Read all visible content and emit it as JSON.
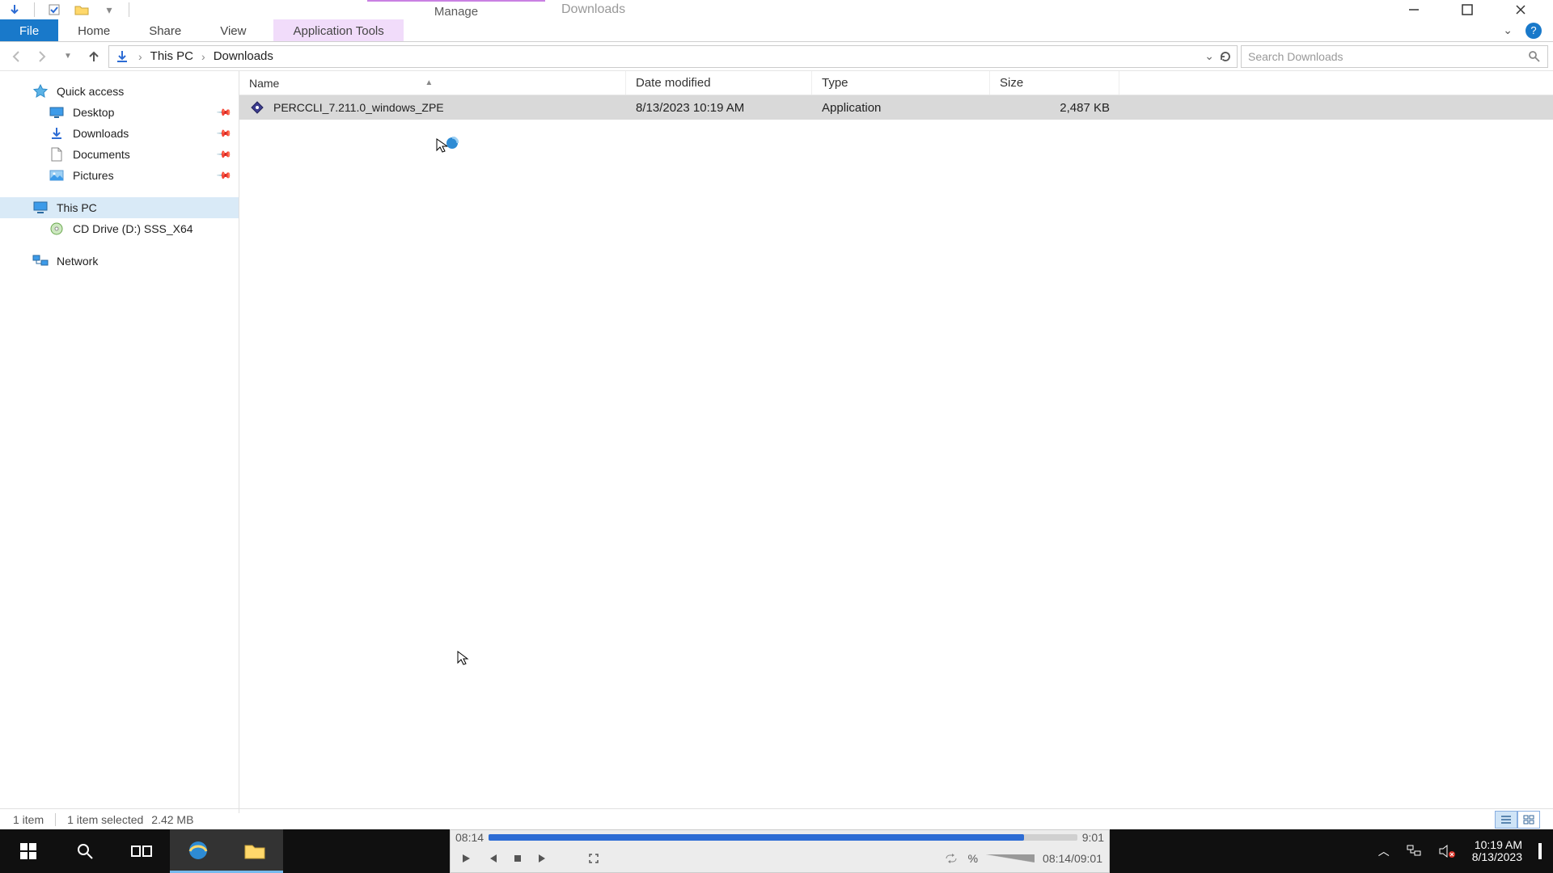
{
  "window": {
    "ctx_tab_top": "Manage",
    "ctx_tab_sub": "Application Tools",
    "title": "Downloads"
  },
  "menu": {
    "file": "File",
    "home": "Home",
    "share": "Share",
    "view": "View"
  },
  "breadcrumb": {
    "root": "This PC",
    "leaf": "Downloads"
  },
  "search": {
    "placeholder": "Search Downloads"
  },
  "tree": {
    "quick_access": "Quick access",
    "desktop": "Desktop",
    "downloads": "Downloads",
    "documents": "Documents",
    "pictures": "Pictures",
    "this_pc": "This PC",
    "cd_drive": "CD Drive (D:) SSS_X64",
    "network": "Network"
  },
  "columns": {
    "name": "Name",
    "date": "Date modified",
    "type": "Type",
    "size": "Size"
  },
  "rows": [
    {
      "name": "PERCCLI_7.211.0_windows_ZPE",
      "date": "8/13/2023 10:19 AM",
      "type": "Application",
      "size": "2,487 KB"
    }
  ],
  "status": {
    "count": "1 item",
    "selected": "1 item selected",
    "size": "2.42 MB"
  },
  "player": {
    "pos": "08:14",
    "total": "9:01",
    "combo": "08:14/09:01",
    "pct": "%"
  },
  "tray": {
    "time": "10:19 AM",
    "date": "8/13/2023"
  }
}
